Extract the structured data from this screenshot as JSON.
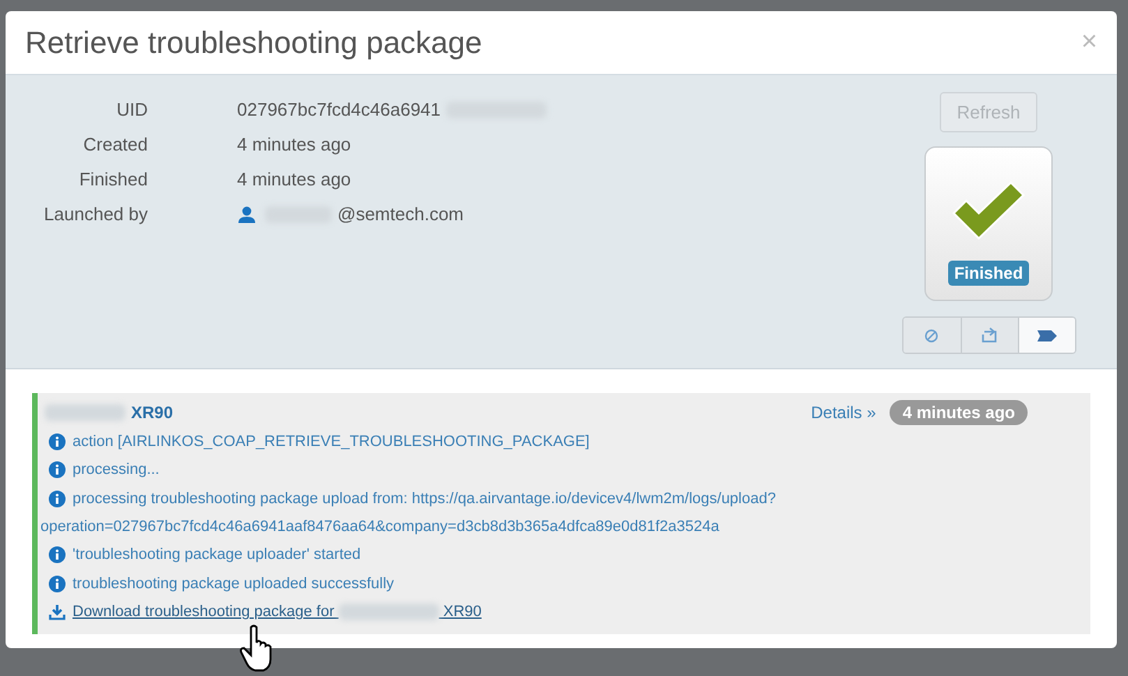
{
  "modal": {
    "title": "Retrieve troubleshooting package",
    "close": "×"
  },
  "details": [
    {
      "label": "UID",
      "value": "027967bc7fcd4c46a6941",
      "redacted": true,
      "kind": "text"
    },
    {
      "label": "Created",
      "value": "4 minutes ago",
      "redacted": false,
      "kind": "text"
    },
    {
      "label": "Finished",
      "value": "4 minutes ago",
      "redacted": false,
      "kind": "text"
    },
    {
      "label": "Launched by",
      "value": "@semtech.com",
      "redacted": true,
      "kind": "user"
    }
  ],
  "refresh": {
    "label": "Refresh",
    "disabled": true
  },
  "status": {
    "label": "Finished"
  },
  "view_buttons": [
    {
      "kind": "cancel",
      "selected": false
    },
    {
      "kind": "retry",
      "selected": false
    },
    {
      "kind": "tag",
      "selected": true
    }
  ],
  "log": {
    "device": "XR90",
    "details_link": "Details »",
    "time": "4 minutes ago",
    "entries": [
      {
        "kind": "info",
        "text": "action [AIRLINKOS_COAP_RETRIEVE_TROUBLESHOOTING_PACKAGE]"
      },
      {
        "kind": "info",
        "text": "processing..."
      },
      {
        "kind": "info",
        "text": "processing troubleshooting package upload from: https://qa.airvantage.io/devicev4/lwm2m/logs/upload?"
      },
      {
        "kind": "continuation",
        "text": "operation=027967bc7fcd4c46a6941aaf8476aa64&company=d3cb8d3b365a4dfca89e0d81f2a3524a"
      },
      {
        "kind": "info",
        "text": "'troubleshooting package uploader' started"
      },
      {
        "kind": "info",
        "text": "troubleshooting package uploaded successfully"
      },
      {
        "kind": "download",
        "text": "Download troubleshooting package for",
        "suffix": "XR90"
      }
    ]
  }
}
